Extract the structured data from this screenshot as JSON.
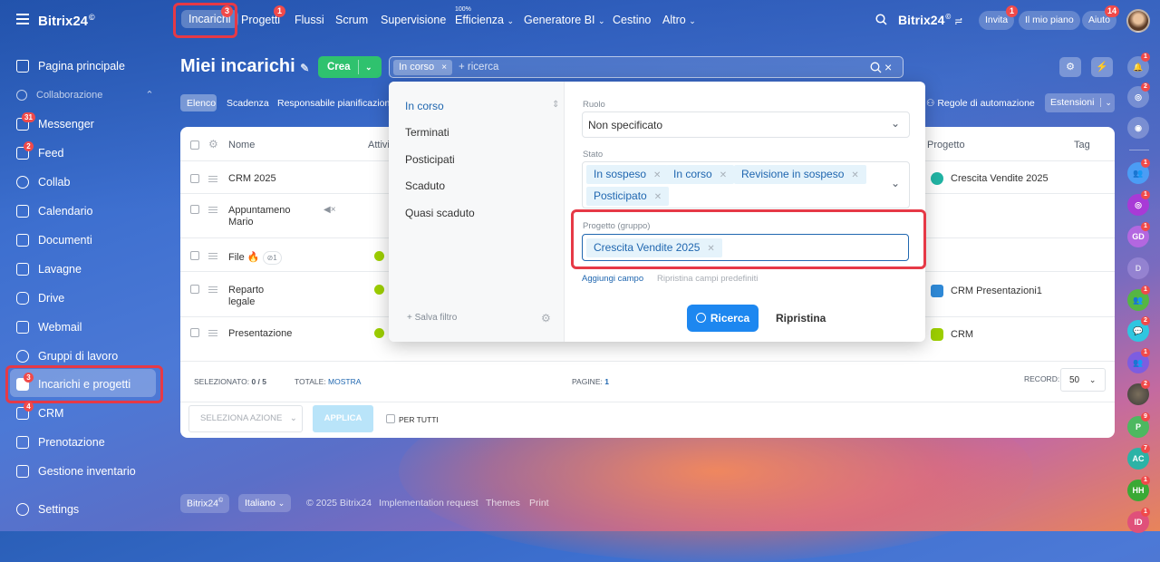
{
  "topbar": {
    "logo": "Bitrix24",
    "logo_mark": "©",
    "tabs": [
      {
        "label": "Incarichi",
        "badge": "3"
      },
      {
        "label": "Progetti",
        "badge": "1"
      },
      {
        "label": "Flussi"
      },
      {
        "label": "Scrum"
      },
      {
        "label": "Supervisione"
      },
      {
        "label": "Efficienza",
        "super": "100%"
      },
      {
        "label": "Generatore BI"
      },
      {
        "label": "Cestino"
      },
      {
        "label": "Altro"
      }
    ],
    "brand_right": "Bitrix24",
    "invite_label": "Invita",
    "invite_badge": "1",
    "plan_label": "Il mio piano",
    "help_label": "Aiuto",
    "help_badge": "14"
  },
  "sidebar": {
    "items": [
      {
        "label": "Pagina principale"
      },
      {
        "label": "Collaborazione"
      },
      {
        "label": "Messenger",
        "badge": "31"
      },
      {
        "label": "Feed",
        "badge": "2"
      },
      {
        "label": "Collab"
      },
      {
        "label": "Calendario"
      },
      {
        "label": "Documenti"
      },
      {
        "label": "Lavagne"
      },
      {
        "label": "Drive"
      },
      {
        "label": "Webmail"
      },
      {
        "label": "Gruppi di lavoro"
      },
      {
        "label": "Incarichi e progetti",
        "badge": "3"
      },
      {
        "label": "CRM",
        "badge": "4"
      },
      {
        "label": "Prenotazione"
      },
      {
        "label": "Gestione inventario"
      },
      {
        "label": "Settings"
      }
    ]
  },
  "page": {
    "title": "Miei incarichi",
    "create_label": "Crea",
    "search_chip": "In corso",
    "search_placeholder": "+ ricerca"
  },
  "views": {
    "list": "Elenco",
    "deadline": "Scadenza",
    "planner": "Responsabile pianificazione",
    "automation": "Regole di automazione",
    "extensions": "Estensioni"
  },
  "table": {
    "col_name": "Nome",
    "col_activity": "Attivi",
    "col_project": "Progetto",
    "col_tag": "Tag",
    "rows": [
      {
        "name": "CRM 2025",
        "project": "Crescita Vendite 2025"
      },
      {
        "name": "Appuntameno Mario",
        "project": ""
      },
      {
        "name": "File",
        "counter": "1",
        "project": ""
      },
      {
        "name": "Reparto legale",
        "project": "CRM Presentazioni1"
      },
      {
        "name": "Presentazione",
        "project": "CRM"
      }
    ],
    "selected_label": "SELEZIONATO:",
    "selected_value": "0 / 5",
    "total_label": "TOTALE:",
    "total_link": "MOSTRA",
    "pages_label": "PAGINE:",
    "pages_value": "1",
    "record_label": "RECORD:",
    "record_value": "50",
    "action_select": "SELEZIONA AZIONE",
    "apply_label": "APPLICA",
    "for_all_label": "PER TUTTI"
  },
  "filter": {
    "presets": [
      "In corso",
      "Terminati",
      "Posticipati",
      "Scaduto",
      "Quasi scaduto"
    ],
    "save_filter": "+ Salva filtro",
    "role_label": "Ruolo",
    "role_value": "Non specificato",
    "state_label": "Stato",
    "state_chips": [
      "In sospeso",
      "In corso",
      "Revisione in sospeso",
      "Posticipato"
    ],
    "project_label": "Progetto (gruppo)",
    "project_chip": "Crescita Vendite 2025",
    "add_field": "Aggiungi campo",
    "reset_fields": "Ripristina campi predefiniti",
    "search_button": "Ricerca",
    "reset_button": "Ripristina"
  },
  "right_sidebar": [
    {
      "label": "",
      "badge": "1"
    },
    {
      "label": "",
      "badge": "2"
    },
    {
      "label": ""
    },
    {
      "label": "",
      "badge": "1"
    },
    {
      "label": "",
      "badge": "1"
    },
    {
      "label": "GD",
      "badge": "1"
    },
    {
      "label": "D"
    },
    {
      "label": "",
      "badge": "1"
    },
    {
      "label": "",
      "badge": "2"
    },
    {
      "label": "",
      "badge": "1"
    },
    {
      "label": "",
      "badge": "2"
    },
    {
      "label": "P",
      "badge": "9"
    },
    {
      "label": "AC",
      "badge": "7"
    },
    {
      "label": "HH",
      "badge": "1"
    },
    {
      "label": "ID",
      "badge": "1"
    }
  ],
  "footer": {
    "brand": "Bitrix24",
    "language": "Italiano",
    "copyright": "© 2025 Bitrix24",
    "impl": "Implementation request",
    "themes": "Themes",
    "print": "Print"
  }
}
